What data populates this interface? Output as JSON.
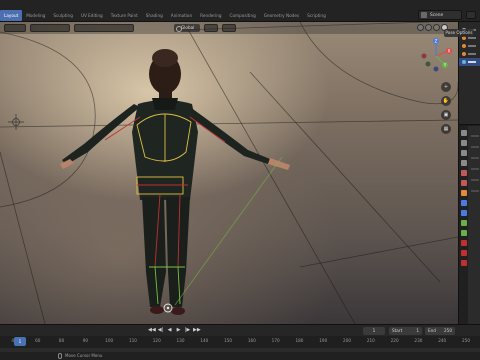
{
  "workspace_tabs": [
    {
      "label": "Layout",
      "active": true
    },
    {
      "label": "Modeling",
      "active": false
    },
    {
      "label": "Sculpting",
      "active": false
    },
    {
      "label": "UV Editing",
      "active": false
    },
    {
      "label": "Texture Paint",
      "active": false
    },
    {
      "label": "Shading",
      "active": false
    },
    {
      "label": "Animation",
      "active": false
    },
    {
      "label": "Rendering",
      "active": false
    },
    {
      "label": "Compositing",
      "active": false
    },
    {
      "label": "Geometry Nodes",
      "active": false
    },
    {
      "label": "Scripting",
      "active": false
    }
  ],
  "scene": {
    "label": "Scene"
  },
  "viewport": {
    "transform_orientation": "Global",
    "pose_options_label": "Pose Options",
    "gizmo_axes": {
      "x": "X",
      "y": "Y",
      "z": "Z"
    }
  },
  "timeline": {
    "playback_icons": [
      "◀◀",
      "◀|",
      "◀",
      "▶",
      "|▶",
      "▶▶"
    ],
    "current_frame": "1",
    "start_label": "Start",
    "start_value": "1",
    "end_label": "End",
    "end_value": "250",
    "playhead_value": "1",
    "ruler_ticks": [
      "40",
      "60",
      "80",
      "90",
      "100",
      "110",
      "120",
      "130",
      "140",
      "150",
      "160",
      "170",
      "180",
      "190",
      "200",
      "210",
      "220",
      "230",
      "240",
      "250"
    ]
  },
  "statusbar": {
    "text": "Move Cursor Menu"
  },
  "colors": {
    "accent": "#4b6fb0",
    "bone_yellow": "#e0c040",
    "bone_green": "#78c040",
    "bone_red": "#c03030",
    "axis_x": "#e04a4a",
    "axis_y": "#6ab04a",
    "axis_z": "#4a7ce0"
  }
}
